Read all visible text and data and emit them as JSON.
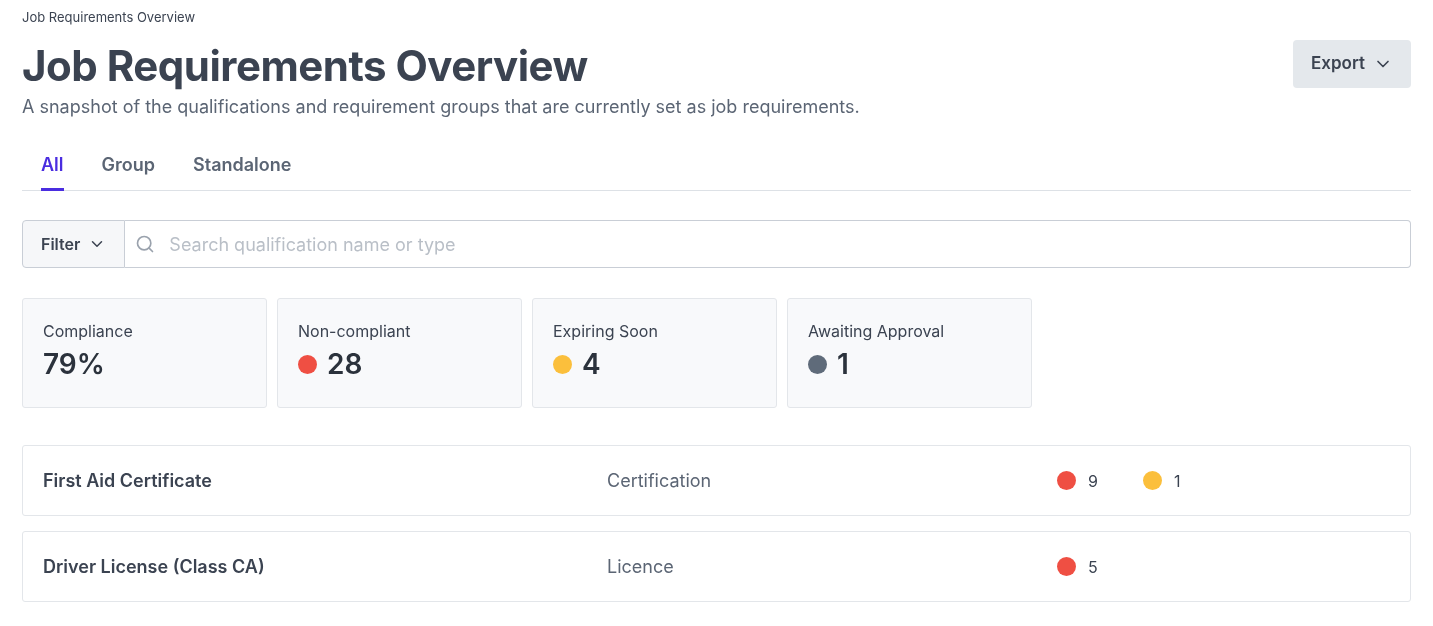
{
  "breadcrumb": "Job Requirements Overview",
  "title": "Job Requirements Overview",
  "description": "A snapshot of the qualifications and requirement groups that are currently set as job requirements.",
  "export_button": "Export",
  "tabs": [
    {
      "label": "All",
      "selected": true
    },
    {
      "label": "Group",
      "selected": false
    },
    {
      "label": "Standalone",
      "selected": false
    }
  ],
  "filter_button": "Filter",
  "search": {
    "placeholder": "Search qualification name or type"
  },
  "stats": [
    {
      "label": "Compliance",
      "value": "79%"
    },
    {
      "label": "Non-compliant",
      "value": "28",
      "color": "#ef4f43"
    },
    {
      "label": "Expiring Soon",
      "value": "4",
      "color": "#fbbf3c"
    },
    {
      "label": "Awaiting Approval",
      "value": "1",
      "color": "#5f6b7a"
    }
  ],
  "rows": [
    {
      "name": "First Aid Certificate",
      "type": "Certification",
      "counts": [
        {
          "value": "9",
          "color": "#ef4f43"
        },
        {
          "value": "1",
          "color": "#fbbf3c"
        }
      ]
    },
    {
      "name": "Driver License (Class CA)",
      "type": "Licence",
      "counts": [
        {
          "value": "5",
          "color": "#ef4f43"
        }
      ]
    }
  ]
}
